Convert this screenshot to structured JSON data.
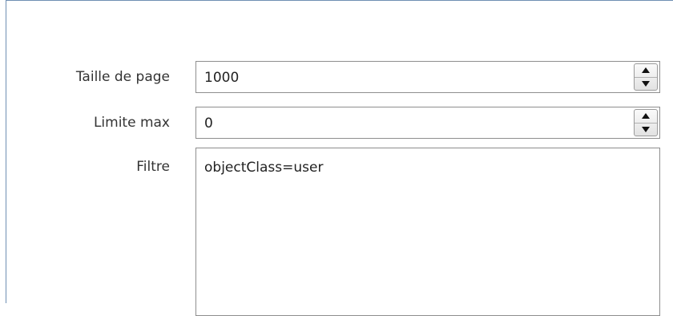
{
  "form": {
    "page_size": {
      "label": "Taille de page",
      "value": "1000"
    },
    "max_limit": {
      "label": "Limite max",
      "value": "0"
    },
    "filter": {
      "label": "Filtre",
      "value": "objectClass=user"
    }
  },
  "icons": {
    "spin_up": "triangle-up-icon",
    "spin_down": "triangle-down-icon"
  },
  "colors": {
    "panel_border": "#6f8fb3",
    "field_border": "#8e8e8e",
    "label_text": "#333333"
  }
}
